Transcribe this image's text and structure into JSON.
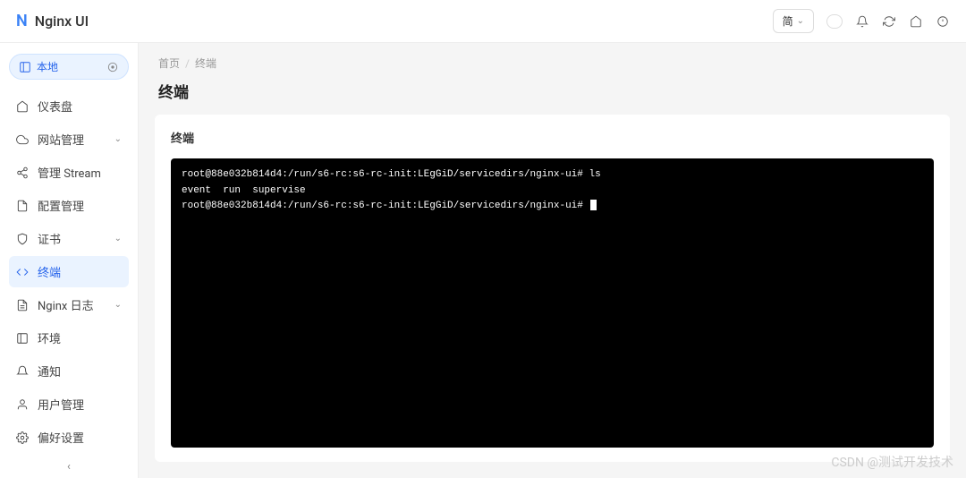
{
  "header": {
    "app_name": "Nginx UI",
    "lang_label": "简"
  },
  "sidebar": {
    "env_label": "本地",
    "items": [
      {
        "label": "仪表盘",
        "icon": "home"
      },
      {
        "label": "网站管理",
        "icon": "cloud",
        "expandable": true
      },
      {
        "label": "管理 Stream",
        "icon": "share"
      },
      {
        "label": "配置管理",
        "icon": "file"
      },
      {
        "label": "证书",
        "icon": "shield",
        "expandable": true
      },
      {
        "label": "终端",
        "icon": "code",
        "active": true
      },
      {
        "label": "Nginx 日志",
        "icon": "file-text",
        "expandable": true
      },
      {
        "label": "环境",
        "icon": "columns"
      },
      {
        "label": "通知",
        "icon": "bell"
      },
      {
        "label": "用户管理",
        "icon": "user"
      },
      {
        "label": "偏好设置",
        "icon": "settings"
      }
    ]
  },
  "breadcrumb": {
    "home": "首页",
    "current": "终端"
  },
  "page": {
    "title": "终端",
    "card_title": "终端"
  },
  "terminal": {
    "lines": [
      "root@88e032b814d4:/run/s6-rc:s6-rc-init:LEgGiD/servicedirs/nginx-ui# ls",
      "event  run  supervise",
      "root@88e032b814d4:/run/s6-rc:s6-rc-init:LEgGiD/servicedirs/nginx-ui# "
    ]
  },
  "watermark": "CSDN @测试开发技术"
}
